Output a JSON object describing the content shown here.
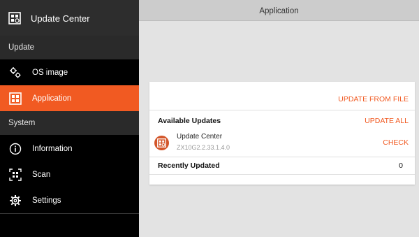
{
  "sidebar": {
    "app_title": "Update Center",
    "sections": {
      "update": "Update",
      "system": "System"
    },
    "items": [
      {
        "label": "OS image",
        "icon": "gears-icon"
      },
      {
        "label": "Application",
        "icon": "app-grid-icon",
        "active": true
      },
      {
        "label": "Information",
        "icon": "info-icon"
      },
      {
        "label": "Scan",
        "icon": "scan-icon"
      },
      {
        "label": "Settings",
        "icon": "gear-icon"
      }
    ]
  },
  "header": {
    "title": "Application"
  },
  "main": {
    "update_from_file": "UPDATE FROM FILE",
    "available_updates": {
      "title": "Available Updates",
      "action": "UPDATE ALL",
      "items": [
        {
          "name": "Update Center",
          "version": "ZX10G2.2.33.1.4.0",
          "action": "CHECK"
        }
      ]
    },
    "recently_updated": {
      "title": "Recently Updated",
      "count": "0"
    }
  },
  "colors": {
    "accent": "#f15a22",
    "sidebar_bg": "#000000",
    "sidebar_header_bg": "#2d2d2d",
    "content_bg": "#e3e3e3"
  }
}
